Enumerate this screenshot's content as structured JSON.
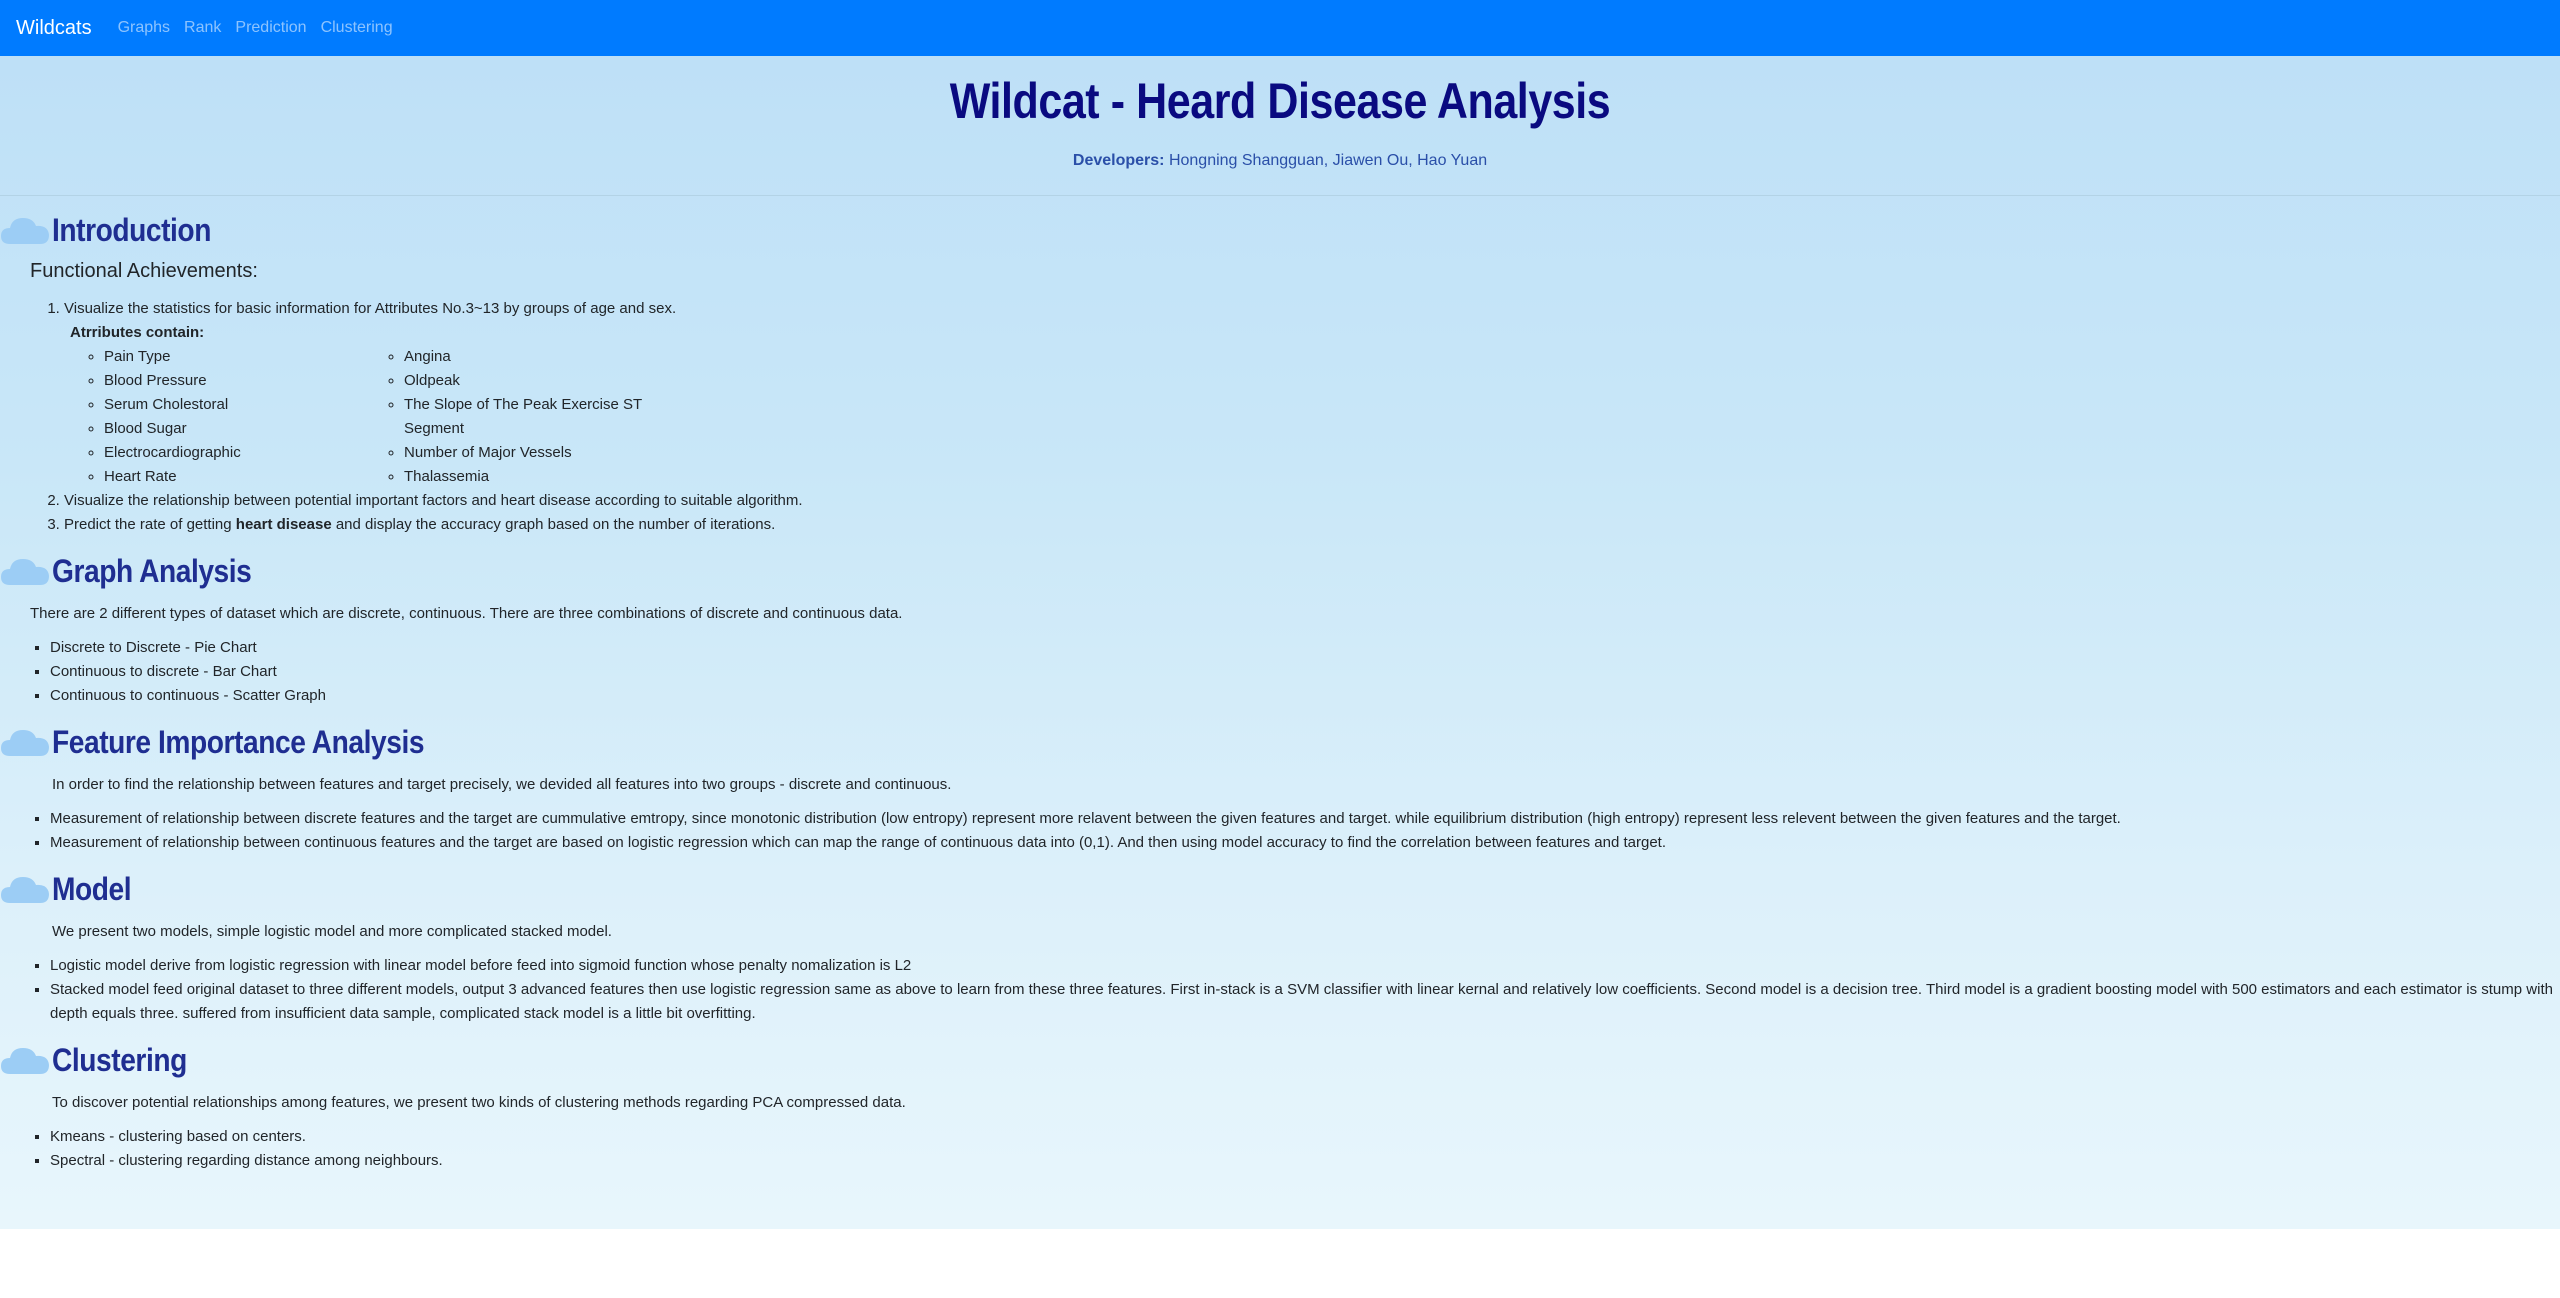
{
  "nav": {
    "brand": "Wildcats",
    "links": [
      "Graphs",
      "Rank",
      "Prediction",
      "Clustering"
    ]
  },
  "header": {
    "title": "Wildcat - Heard Disease Analysis",
    "developers_label": "Developers:",
    "developers": "Hongning Shangguan, Jiawen Ou, Hao Yuan"
  },
  "intro": {
    "title": "Introduction",
    "subtitle": "Functional Achievements:",
    "item1": "Visualize the statistics for basic information for Attributes No.3~13 by groups of age and sex.",
    "attr_label": "Atrributes contain:",
    "attrs_left": [
      "Pain Type",
      "Blood Pressure",
      "Serum Cholestoral",
      "Blood Sugar",
      "Electrocardiographic",
      "Heart Rate"
    ],
    "attrs_right": [
      "Angina",
      "Oldpeak",
      "The Slope of The Peak Exercise ST Segment",
      "Number of Major Vessels",
      "Thalassemia"
    ],
    "item2": "Visualize the relationship between potential important factors and heart disease according to suitable algorithm.",
    "item3_pre": "Predict the rate of getting ",
    "item3_bold": "heart disease",
    "item3_post": " and display the accuracy graph based on the number of iterations."
  },
  "graph": {
    "title": "Graph Analysis",
    "text": "There are 2 different types of dataset which are discrete, continuous. There are three combinations of discrete and continuous data.",
    "items": [
      "Discrete to Discrete - Pie Chart",
      "Continuous to discrete - Bar Chart",
      "Continuous to continuous - Scatter Graph"
    ]
  },
  "feature": {
    "title": "Feature Importance Analysis",
    "text": "In order to find the relationship between features and target precisely, we devided all features into two groups - discrete and continuous.",
    "items": [
      "Measurement of relationship between discrete features and the target are cummulative emtropy, since monotonic distribution (low entropy) represent more relavent between the given features and target. while equilibrium distribution (high entropy) represent less relevent between the given features and the target.",
      "Measurement of relationship between continuous features and the target are based on logistic regression which can map the range of continuous data into (0,1). And then using model accuracy to find the correlation between features and target."
    ]
  },
  "model": {
    "title": "Model",
    "text": "We present two models, simple logistic model and more complicated stacked model.",
    "items": [
      "Logistic model derive from logistic regression with linear model before feed into sigmoid function whose penalty nomalization is L2",
      "Stacked model feed original dataset to three different models, output 3 advanced features then use logistic regression same as above to learn from these three features. First in-stack is a SVM classifier with linear kernal and relatively low coefficients. Second model is a decision tree. Third model is a gradient boosting model with 500 estimators and each estimator is stump with depth equals three. suffered from insufficient data sample, complicated stack model is a little bit overfitting."
    ]
  },
  "clustering": {
    "title": "Clustering",
    "text": "To discover potential relationships among features, we present two kinds of clustering methods regarding PCA compressed data.",
    "items": [
      "Kmeans - clustering based on centers.",
      "Spectral - clustering regarding distance among neighbours."
    ]
  },
  "colors": {
    "navbar": "#007bff",
    "title": "#0a0a80",
    "section_title": "#1f2e91",
    "cloud": "#9ccdf5"
  },
  "icons": {
    "section": "cloud-icon"
  }
}
